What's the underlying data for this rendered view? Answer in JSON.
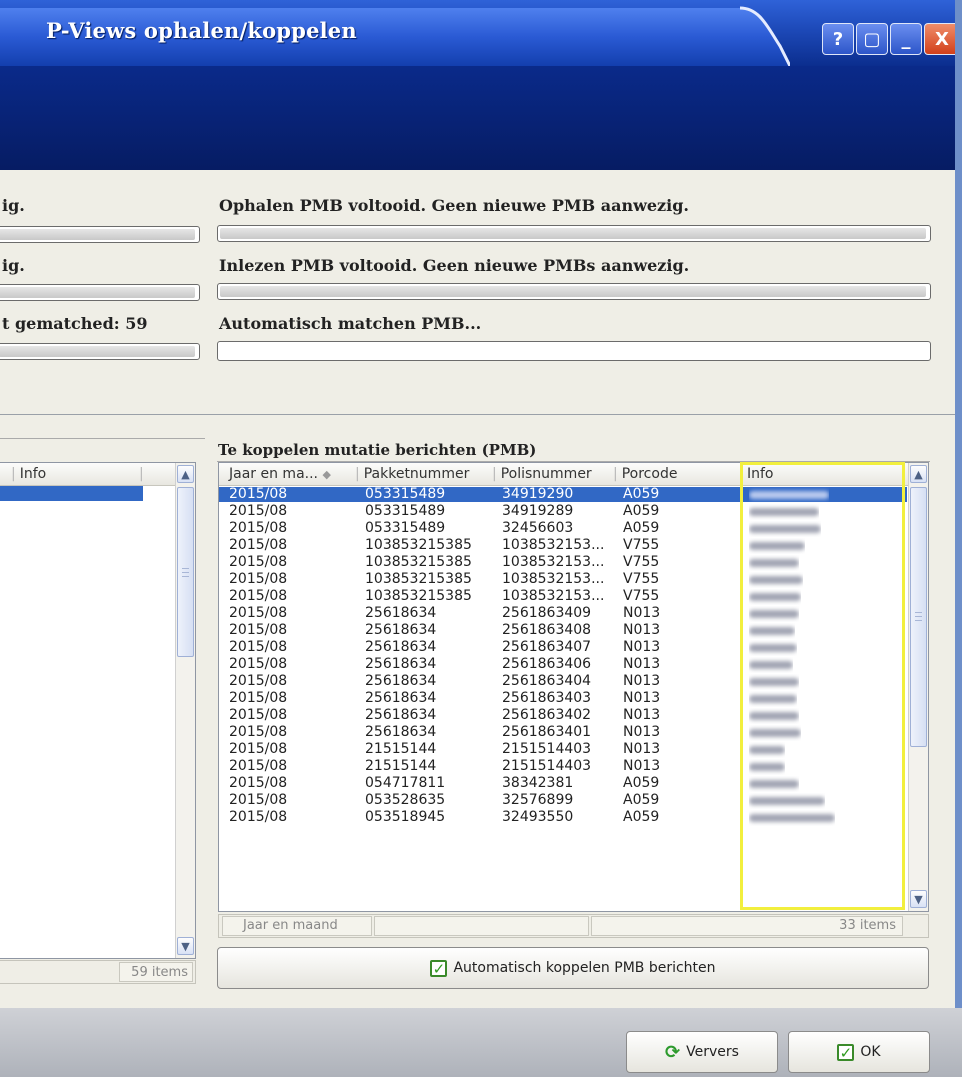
{
  "window": {
    "title": "P-Views ophalen/koppelen",
    "buttons": {
      "help": "?",
      "restore": "▢",
      "minimize": "_",
      "close": "X"
    }
  },
  "progress": {
    "left_labels": [
      "ig.",
      "ig.",
      "t gematched: 59"
    ],
    "right": [
      {
        "label": "Ophalen PMB voltooid. Geen nieuwe PMB aanwezig.",
        "value": 1.0
      },
      {
        "label": "Inlezen PMB voltooid. Geen nieuwe PMBs aanwezig.",
        "value": 1.0
      },
      {
        "label": "Automatisch matchen PMB...",
        "value": 0.0
      }
    ]
  },
  "left_list": {
    "header_info": "Info",
    "status_count": "59 items"
  },
  "right_list": {
    "group_title": "Te koppelen mutatie berichten (PMB)",
    "columns": [
      "Jaar en ma...",
      "Pakketnummer",
      "Polisnummer",
      "Porcode",
      "Info"
    ],
    "rows": [
      [
        "2015/08",
        "053315489",
        "34919290",
        "A059"
      ],
      [
        "2015/08",
        "053315489",
        "34919289",
        "A059"
      ],
      [
        "2015/08",
        "053315489",
        "32456603",
        "A059"
      ],
      [
        "2015/08",
        "103853215385",
        "1038532153...",
        "V755"
      ],
      [
        "2015/08",
        "103853215385",
        "1038532153...",
        "V755"
      ],
      [
        "2015/08",
        "103853215385",
        "1038532153...",
        "V755"
      ],
      [
        "2015/08",
        "103853215385",
        "1038532153...",
        "V755"
      ],
      [
        "2015/08",
        "25618634",
        "2561863409",
        "N013"
      ],
      [
        "2015/08",
        "25618634",
        "2561863408",
        "N013"
      ],
      [
        "2015/08",
        "25618634",
        "2561863407",
        "N013"
      ],
      [
        "2015/08",
        "25618634",
        "2561863406",
        "N013"
      ],
      [
        "2015/08",
        "25618634",
        "2561863404",
        "N013"
      ],
      [
        "2015/08",
        "25618634",
        "2561863403",
        "N013"
      ],
      [
        "2015/08",
        "25618634",
        "2561863402",
        "N013"
      ],
      [
        "2015/08",
        "25618634",
        "2561863401",
        "N013"
      ],
      [
        "2015/08",
        "21515144",
        "2151514403",
        "N013"
      ],
      [
        "2015/08",
        "21515144",
        "2151514403",
        "N013"
      ],
      [
        "2015/08",
        "054717811",
        "38342381",
        "A059"
      ],
      [
        "2015/08",
        "053528635",
        "32576899",
        "A059"
      ],
      [
        "2015/08",
        "053518945",
        "32493550",
        "A059"
      ]
    ],
    "selected_row": 0,
    "status_group": "Jaar en maand",
    "status_count": "33 items"
  },
  "auto_link": {
    "label": "Automatisch koppelen PMB berichten",
    "checked": true
  },
  "footer": {
    "refresh_label": "Ververs",
    "ok_label": "OK"
  }
}
